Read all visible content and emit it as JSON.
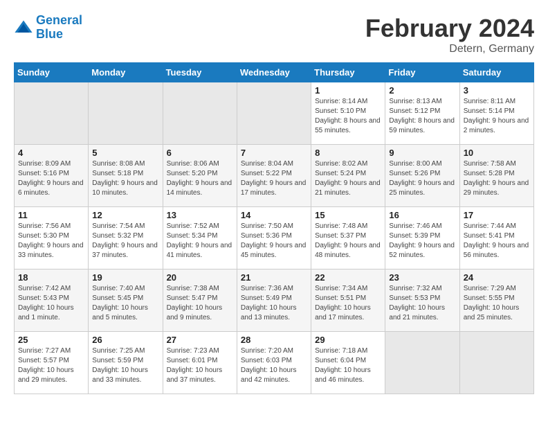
{
  "header": {
    "logo_line1": "General",
    "logo_line2": "Blue",
    "title": "February 2024",
    "subtitle": "Detern, Germany"
  },
  "weekdays": [
    "Sunday",
    "Monday",
    "Tuesday",
    "Wednesday",
    "Thursday",
    "Friday",
    "Saturday"
  ],
  "weeks": [
    [
      {
        "day": "",
        "sunrise": "",
        "sunset": "",
        "daylight": ""
      },
      {
        "day": "",
        "sunrise": "",
        "sunset": "",
        "daylight": ""
      },
      {
        "day": "",
        "sunrise": "",
        "sunset": "",
        "daylight": ""
      },
      {
        "day": "",
        "sunrise": "",
        "sunset": "",
        "daylight": ""
      },
      {
        "day": "1",
        "sunrise": "Sunrise: 8:14 AM",
        "sunset": "Sunset: 5:10 PM",
        "daylight": "Daylight: 8 hours and 55 minutes."
      },
      {
        "day": "2",
        "sunrise": "Sunrise: 8:13 AM",
        "sunset": "Sunset: 5:12 PM",
        "daylight": "Daylight: 8 hours and 59 minutes."
      },
      {
        "day": "3",
        "sunrise": "Sunrise: 8:11 AM",
        "sunset": "Sunset: 5:14 PM",
        "daylight": "Daylight: 9 hours and 2 minutes."
      }
    ],
    [
      {
        "day": "4",
        "sunrise": "Sunrise: 8:09 AM",
        "sunset": "Sunset: 5:16 PM",
        "daylight": "Daylight: 9 hours and 6 minutes."
      },
      {
        "day": "5",
        "sunrise": "Sunrise: 8:08 AM",
        "sunset": "Sunset: 5:18 PM",
        "daylight": "Daylight: 9 hours and 10 minutes."
      },
      {
        "day": "6",
        "sunrise": "Sunrise: 8:06 AM",
        "sunset": "Sunset: 5:20 PM",
        "daylight": "Daylight: 9 hours and 14 minutes."
      },
      {
        "day": "7",
        "sunrise": "Sunrise: 8:04 AM",
        "sunset": "Sunset: 5:22 PM",
        "daylight": "Daylight: 9 hours and 17 minutes."
      },
      {
        "day": "8",
        "sunrise": "Sunrise: 8:02 AM",
        "sunset": "Sunset: 5:24 PM",
        "daylight": "Daylight: 9 hours and 21 minutes."
      },
      {
        "day": "9",
        "sunrise": "Sunrise: 8:00 AM",
        "sunset": "Sunset: 5:26 PM",
        "daylight": "Daylight: 9 hours and 25 minutes."
      },
      {
        "day": "10",
        "sunrise": "Sunrise: 7:58 AM",
        "sunset": "Sunset: 5:28 PM",
        "daylight": "Daylight: 9 hours and 29 minutes."
      }
    ],
    [
      {
        "day": "11",
        "sunrise": "Sunrise: 7:56 AM",
        "sunset": "Sunset: 5:30 PM",
        "daylight": "Daylight: 9 hours and 33 minutes."
      },
      {
        "day": "12",
        "sunrise": "Sunrise: 7:54 AM",
        "sunset": "Sunset: 5:32 PM",
        "daylight": "Daylight: 9 hours and 37 minutes."
      },
      {
        "day": "13",
        "sunrise": "Sunrise: 7:52 AM",
        "sunset": "Sunset: 5:34 PM",
        "daylight": "Daylight: 9 hours and 41 minutes."
      },
      {
        "day": "14",
        "sunrise": "Sunrise: 7:50 AM",
        "sunset": "Sunset: 5:36 PM",
        "daylight": "Daylight: 9 hours and 45 minutes."
      },
      {
        "day": "15",
        "sunrise": "Sunrise: 7:48 AM",
        "sunset": "Sunset: 5:37 PM",
        "daylight": "Daylight: 9 hours and 48 minutes."
      },
      {
        "day": "16",
        "sunrise": "Sunrise: 7:46 AM",
        "sunset": "Sunset: 5:39 PM",
        "daylight": "Daylight: 9 hours and 52 minutes."
      },
      {
        "day": "17",
        "sunrise": "Sunrise: 7:44 AM",
        "sunset": "Sunset: 5:41 PM",
        "daylight": "Daylight: 9 hours and 56 minutes."
      }
    ],
    [
      {
        "day": "18",
        "sunrise": "Sunrise: 7:42 AM",
        "sunset": "Sunset: 5:43 PM",
        "daylight": "Daylight: 10 hours and 1 minute."
      },
      {
        "day": "19",
        "sunrise": "Sunrise: 7:40 AM",
        "sunset": "Sunset: 5:45 PM",
        "daylight": "Daylight: 10 hours and 5 minutes."
      },
      {
        "day": "20",
        "sunrise": "Sunrise: 7:38 AM",
        "sunset": "Sunset: 5:47 PM",
        "daylight": "Daylight: 10 hours and 9 minutes."
      },
      {
        "day": "21",
        "sunrise": "Sunrise: 7:36 AM",
        "sunset": "Sunset: 5:49 PM",
        "daylight": "Daylight: 10 hours and 13 minutes."
      },
      {
        "day": "22",
        "sunrise": "Sunrise: 7:34 AM",
        "sunset": "Sunset: 5:51 PM",
        "daylight": "Daylight: 10 hours and 17 minutes."
      },
      {
        "day": "23",
        "sunrise": "Sunrise: 7:32 AM",
        "sunset": "Sunset: 5:53 PM",
        "daylight": "Daylight: 10 hours and 21 minutes."
      },
      {
        "day": "24",
        "sunrise": "Sunrise: 7:29 AM",
        "sunset": "Sunset: 5:55 PM",
        "daylight": "Daylight: 10 hours and 25 minutes."
      }
    ],
    [
      {
        "day": "25",
        "sunrise": "Sunrise: 7:27 AM",
        "sunset": "Sunset: 5:57 PM",
        "daylight": "Daylight: 10 hours and 29 minutes."
      },
      {
        "day": "26",
        "sunrise": "Sunrise: 7:25 AM",
        "sunset": "Sunset: 5:59 PM",
        "daylight": "Daylight: 10 hours and 33 minutes."
      },
      {
        "day": "27",
        "sunrise": "Sunrise: 7:23 AM",
        "sunset": "Sunset: 6:01 PM",
        "daylight": "Daylight: 10 hours and 37 minutes."
      },
      {
        "day": "28",
        "sunrise": "Sunrise: 7:20 AM",
        "sunset": "Sunset: 6:03 PM",
        "daylight": "Daylight: 10 hours and 42 minutes."
      },
      {
        "day": "29",
        "sunrise": "Sunrise: 7:18 AM",
        "sunset": "Sunset: 6:04 PM",
        "daylight": "Daylight: 10 hours and 46 minutes."
      },
      {
        "day": "",
        "sunrise": "",
        "sunset": "",
        "daylight": ""
      },
      {
        "day": "",
        "sunrise": "",
        "sunset": "",
        "daylight": ""
      }
    ]
  ]
}
